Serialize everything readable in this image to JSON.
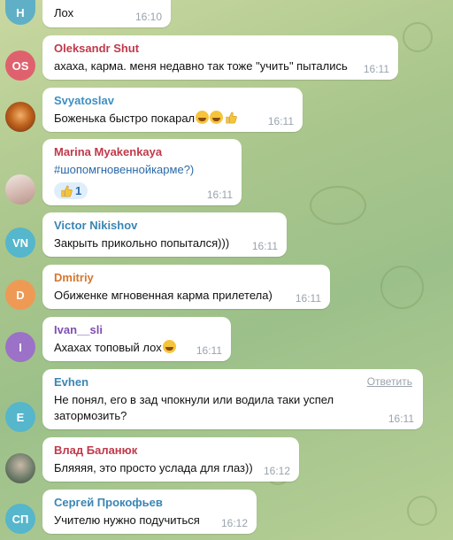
{
  "messages": [
    {
      "initials": "H",
      "avatar_color": "#5fb0c6",
      "sender": "",
      "text": "Лох",
      "time": "16:10"
    },
    {
      "initials": "OS",
      "avatar_color": "#e0616e",
      "sender": "Oleksandr Shut",
      "name_color": "#c0394b",
      "text": "ахаха, карма. меня недавно так тоже \"учить\" пытались",
      "time": "16:11"
    },
    {
      "initials": "",
      "avatar_color": "#7a3b12",
      "sender": "Svyatoslav",
      "name_color": "#3d8fc2",
      "text": "Боженька быстро покарал",
      "emojis": [
        "joy-emoji",
        "joy-emoji",
        "thumbs-up-emoji"
      ],
      "time": "16:11"
    },
    {
      "initials": "",
      "avatar_color": "#d9c8c0",
      "sender": "Marina Myakenkaya",
      "name_color": "#c0394b",
      "text": "#шопомгновеннойкарме?)",
      "reaction": {
        "icon": "thumbs-up-emoji",
        "count": "1"
      },
      "time": "16:11"
    },
    {
      "initials": "VN",
      "avatar_color": "#55b6cc",
      "sender": "Victor Nikishov",
      "name_color": "#3a86b4",
      "text": "Закрыть прикольно попытался)))",
      "time": "16:11"
    },
    {
      "initials": "D",
      "avatar_color": "#ee9a55",
      "sender": "Dmitriy",
      "name_color": "#d5772f",
      "text": "Обиженке мгновенная карма прилетела)",
      "time": "16:11"
    },
    {
      "initials": "I",
      "avatar_color": "#9b72c7",
      "sender": "Ivan__sli",
      "name_color": "#7f4fb3",
      "text": "Ахахах топовый лох",
      "emojis": [
        "joy-emoji"
      ],
      "time": "16:11"
    },
    {
      "initials": "E",
      "avatar_color": "#55b6cc",
      "sender": "Evhen",
      "name_color": "#3a86b4",
      "reply": "Ответить",
      "text": "Не понял, его в зад чпокнули или водила таки успел затормозить?",
      "time": "16:11"
    },
    {
      "initials": "",
      "avatar_color": "#7a8a76",
      "sender": "Влад Баланюк",
      "name_color": "#c0394b",
      "text": "Бляяяя, это просто услада для глаз))",
      "time": "16:12"
    },
    {
      "initials": "СП",
      "avatar_color": "#55b6cc",
      "sender": "Сергей Прокофьев",
      "name_color": "#3a86b4",
      "text": "Учителю нужно подучиться",
      "time": "16:12"
    }
  ]
}
